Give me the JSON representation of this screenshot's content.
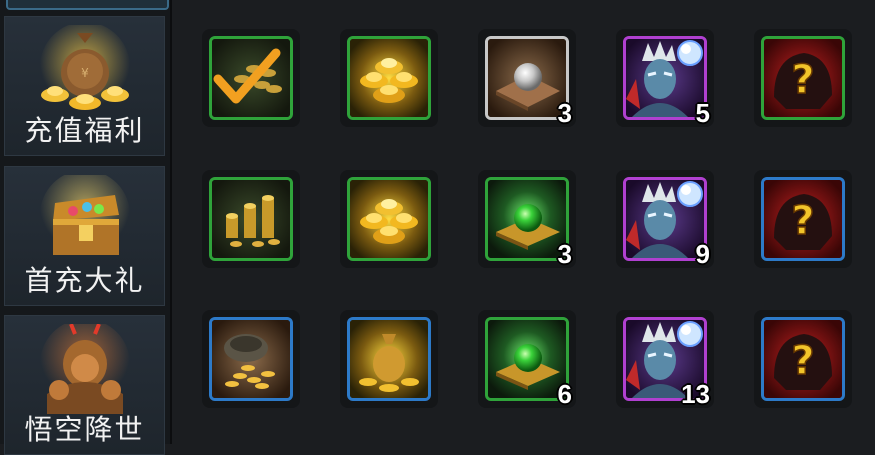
{
  "sidebar": {
    "items": [
      {
        "label": "充值福利",
        "icon": "money-bag-icon"
      },
      {
        "label": "首充大礼",
        "icon": "treasure-chest-icon"
      },
      {
        "label": "悟空降世",
        "icon": "wukong-armor-icon"
      }
    ]
  },
  "rewards": [
    [
      {
        "icon": "gold-coins-check-icon",
        "rarity": "green",
        "count": ""
      },
      {
        "icon": "gold-ingots-icon",
        "rarity": "green",
        "count": ""
      },
      {
        "icon": "white-orb-icon",
        "rarity": "white",
        "count": "3"
      },
      {
        "icon": "hero-fragment-icon",
        "rarity": "purple",
        "count": "5"
      },
      {
        "icon": "mystery-armor-icon",
        "rarity": "green",
        "count": ""
      }
    ],
    [
      {
        "icon": "gold-coin-stacks-icon",
        "rarity": "green",
        "count": ""
      },
      {
        "icon": "gold-ingots-icon",
        "rarity": "green",
        "count": ""
      },
      {
        "icon": "green-orb-icon",
        "rarity": "green",
        "count": "3"
      },
      {
        "icon": "hero-fragment-icon",
        "rarity": "purple",
        "count": "9"
      },
      {
        "icon": "mystery-armor-icon",
        "rarity": "blue",
        "count": ""
      }
    ],
    [
      {
        "icon": "coin-pot-icon",
        "rarity": "blue",
        "count": ""
      },
      {
        "icon": "gold-sack-icon",
        "rarity": "blue",
        "count": ""
      },
      {
        "icon": "green-orb-icon",
        "rarity": "green",
        "count": "6"
      },
      {
        "icon": "hero-fragment-icon",
        "rarity": "purple",
        "count": "13"
      },
      {
        "icon": "mystery-armor-icon",
        "rarity": "blue",
        "count": ""
      }
    ]
  ],
  "colors": {
    "green": "#2fa33a",
    "blue": "#2d7ac8",
    "white": "#c8c8c8",
    "purple": "#b040d0",
    "background": "#1b1d20"
  }
}
